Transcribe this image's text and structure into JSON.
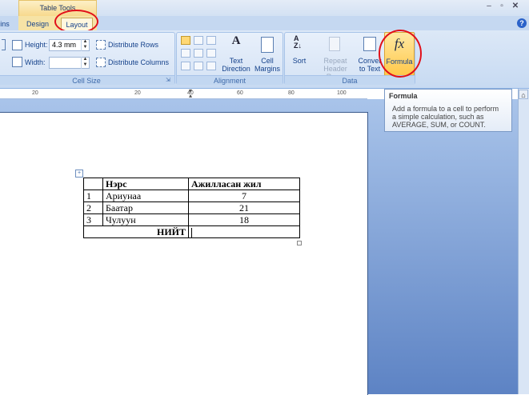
{
  "context_tab_group": "Table Tools",
  "tabs": [
    {
      "label": "ins",
      "active": false
    },
    {
      "label": "Design",
      "active": false
    },
    {
      "label": "Layout",
      "active": true
    }
  ],
  "cell_size": {
    "height_label": "Height:",
    "height_value": "4.3 mm",
    "width_label": "Width:",
    "width_value": "",
    "distribute_rows": "Distribute Rows",
    "distribute_columns": "Distribute Columns",
    "group_label": "Cell Size"
  },
  "alignment": {
    "text_direction": "Text\nDirection",
    "text_direction_1": "Text",
    "text_direction_2": "Direction",
    "cell_margins_1": "Cell",
    "cell_margins_2": "Margins",
    "group_label": "Alignment"
  },
  "data_group": {
    "sort": "Sort",
    "repeat_1": "Repeat",
    "repeat_2": "Header Rows",
    "convert_1": "Conver",
    "convert_2": "to Text",
    "formula": "Formula",
    "formula_icon": "fx",
    "group_label": "Data"
  },
  "ruler": [
    "20",
    "20",
    "40",
    "60",
    "80",
    "100"
  ],
  "tooltip": {
    "title": "Formula",
    "body_1": "Add a formula to a cell to perform",
    "body_2": "a simple calculation, such as",
    "body_3": "AVERAGE, SUM, or COUNT."
  },
  "table": {
    "header": [
      "",
      "Нэрс",
      "Ажилласан жил"
    ],
    "rows": [
      [
        "1",
        "Ариунаа",
        "7"
      ],
      [
        "2",
        "Баатар",
        "21"
      ],
      [
        "3",
        "Чулуун",
        "18"
      ]
    ],
    "total_label": "НИЙТ"
  },
  "colors": {
    "highlight_red": "#e1101a",
    "selected_button": "#ffd875"
  }
}
